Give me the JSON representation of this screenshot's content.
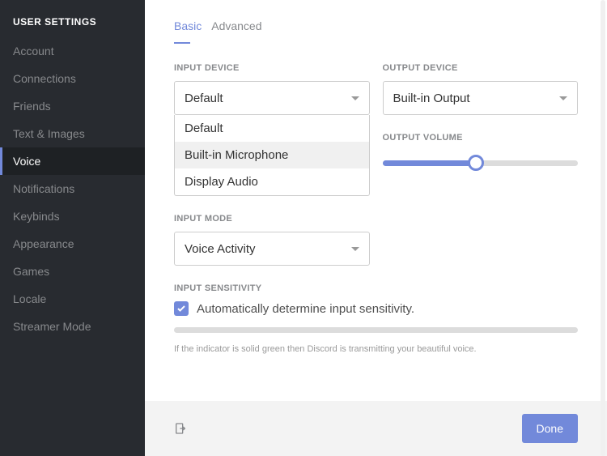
{
  "sidebar": {
    "title": "USER SETTINGS",
    "items": [
      {
        "label": "Account"
      },
      {
        "label": "Connections"
      },
      {
        "label": "Friends"
      },
      {
        "label": "Text & Images"
      },
      {
        "label": "Voice",
        "selected": true
      },
      {
        "label": "Notifications"
      },
      {
        "label": "Keybinds"
      },
      {
        "label": "Appearance"
      },
      {
        "label": "Games"
      },
      {
        "label": "Locale"
      },
      {
        "label": "Streamer Mode"
      }
    ]
  },
  "tabs": {
    "basic": "Basic",
    "advanced": "Advanced"
  },
  "input_device": {
    "label": "INPUT DEVICE",
    "value": "Default",
    "options": [
      "Default",
      "Built-in Microphone",
      "Display Audio"
    ]
  },
  "output_device": {
    "label": "OUTPUT DEVICE",
    "value": "Built-in Output"
  },
  "output_volume": {
    "label": "OUTPUT VOLUME",
    "percent": 48
  },
  "input_mode": {
    "label": "INPUT MODE",
    "value": "Voice Activity"
  },
  "input_sensitivity": {
    "label": "INPUT SENSITIVITY",
    "checkbox_label": "Automatically determine input sensitivity.",
    "checked": true,
    "hint": "If the indicator is solid green then Discord is transmitting your beautiful voice."
  },
  "footer": {
    "done": "Done"
  }
}
